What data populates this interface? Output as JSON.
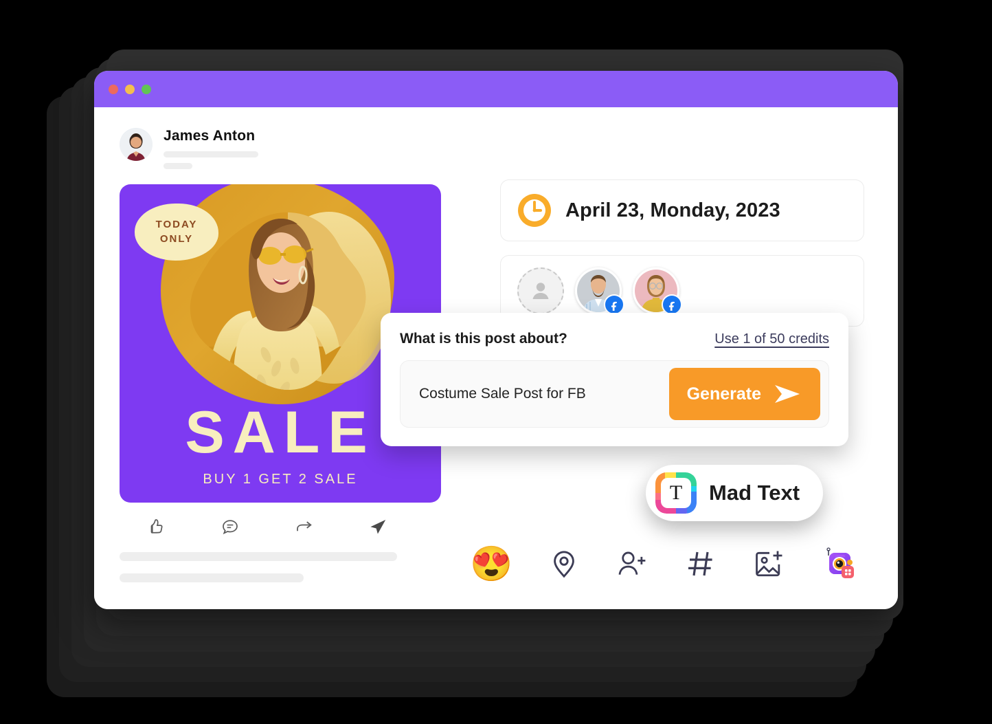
{
  "window": {
    "titlebar": {
      "controls": [
        {
          "name": "close",
          "color": "#ED6A5E"
        },
        {
          "name": "minimize",
          "color": "#F4BE4F"
        },
        {
          "name": "maximize",
          "color": "#61C454"
        }
      ],
      "color": "#8B5CF6"
    }
  },
  "post": {
    "author_name": "James Anton",
    "avatar_icon": "user-photo-avatar",
    "poster": {
      "badge_line1": "TODAY",
      "badge_line2": "ONLY",
      "headline": "SALE",
      "subline": "BUY 1 GET 2 SALE",
      "background_color": "#7E3AF2",
      "text_color": "#F8EEBF",
      "badge_text_color": "#8C4A21"
    },
    "actions": [
      {
        "icon": "thumbs-up-icon",
        "label": "Like"
      },
      {
        "icon": "comment-icon",
        "label": "Comment"
      },
      {
        "icon": "share-arrow-icon",
        "label": "Share"
      },
      {
        "icon": "send-icon",
        "label": "Send"
      }
    ]
  },
  "schedule": {
    "clock_icon": "clock-icon",
    "date_text": "April 23, Monday, 2023",
    "accent_color": "#F9AC2A"
  },
  "accounts": {
    "items": [
      {
        "type": "placeholder",
        "icon": "person-placeholder-icon",
        "network": ""
      },
      {
        "type": "photo",
        "icon": "man-avatar",
        "network": "facebook"
      },
      {
        "type": "photo",
        "icon": "woman-avatar",
        "network": "facebook"
      }
    ],
    "facebook_color": "#1877F2"
  },
  "prompt": {
    "question": "What is this post about?",
    "credits_label": "Use 1 of 50 credits",
    "input_value": "Costume Sale Post for FB",
    "input_placeholder": "Costume Sale Post for FB",
    "generate_label": "Generate",
    "generate_icon": "play-arrow-icon",
    "generate_color": "#F89A28"
  },
  "mad_text_badge": {
    "label": "Mad Text",
    "icon": "mad-text-app-icon",
    "icon_letter": "T"
  },
  "toolbar": {
    "items": [
      {
        "icon": "heart-eyes-emoji-icon",
        "glyph": "😍",
        "label": "Emoji"
      },
      {
        "icon": "location-pin-icon",
        "label": "Location"
      },
      {
        "icon": "add-person-icon",
        "label": "Tag people"
      },
      {
        "icon": "hashtag-icon",
        "label": "Hashtag"
      },
      {
        "icon": "add-image-icon",
        "label": "Add image"
      },
      {
        "icon": "camera-app-icon",
        "label": "Camera app"
      }
    ]
  }
}
